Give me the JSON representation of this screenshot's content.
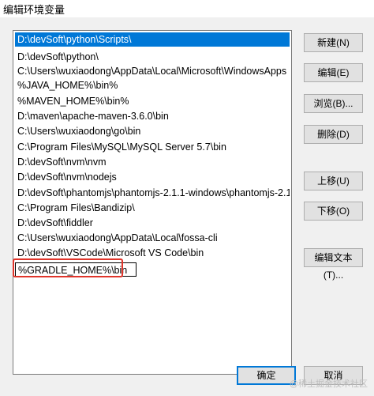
{
  "window": {
    "title": "编辑环境变量"
  },
  "path_list": {
    "items": [
      "D:\\devSoft\\python\\Scripts\\",
      "D:\\devSoft\\python\\",
      "C:\\Users\\wuxiaodong\\AppData\\Local\\Microsoft\\WindowsApps",
      "%JAVA_HOME%\\bin%",
      "%MAVEN_HOME%\\bin%",
      "D:\\maven\\apache-maven-3.6.0\\bin",
      "C:\\Users\\wuxiaodong\\go\\bin",
      "C:\\Program Files\\MySQL\\MySQL Server 5.7\\bin",
      "D:\\devSoft\\nvm\\nvm",
      "D:\\devSoft\\nvm\\nodejs",
      "D:\\devSoft\\phantomjs\\phantomjs-2.1.1-windows\\phantomjs-2.1...",
      "C:\\Program Files\\Bandizip\\",
      "D:\\devSoft\\fiddler",
      "C:\\Users\\wuxiaodong\\AppData\\Local\\fossa-cli",
      "D:\\devSoft\\VSCode\\Microsoft VS Code\\bin",
      "%GRADLE_HOME%\\bin"
    ]
  },
  "buttons": {
    "new": "新建(N)",
    "edit": "编辑(E)",
    "browse": "浏览(B)...",
    "delete": "删除(D)",
    "move_up": "上移(U)",
    "move_down": "下移(O)",
    "edit_text": "编辑文本(T)...",
    "ok": "确定",
    "cancel": "取消"
  },
  "watermark": "@稀土掘金技术社区"
}
